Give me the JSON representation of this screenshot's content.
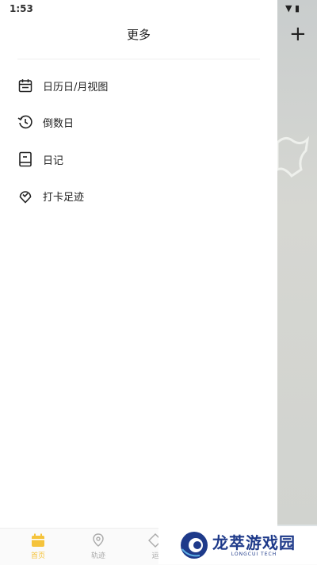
{
  "status_bar": {
    "time": "1:53",
    "signal_icon": "wifi-icon",
    "battery_icon": "battery-icon"
  },
  "drawer": {
    "title": "更多",
    "items": [
      {
        "label": "日历日/月视图",
        "icon": "calendar-icon"
      },
      {
        "label": "倒数日",
        "icon": "history-icon"
      },
      {
        "label": "日记",
        "icon": "book-icon"
      },
      {
        "label": "打卡足迹",
        "icon": "location-heart-icon"
      }
    ]
  },
  "background_app": {
    "add_label": "+",
    "bottom_nav": [
      {
        "label": "首页",
        "active": true
      },
      {
        "label": "轨迹",
        "active": false
      },
      {
        "label": "运",
        "active": false
      }
    ]
  },
  "watermark": {
    "main": "龙萃游戏园",
    "sub": "LONGCUI TECH"
  },
  "colors": {
    "accent": "#f5c33b",
    "watermark": "#1e3a8a"
  }
}
